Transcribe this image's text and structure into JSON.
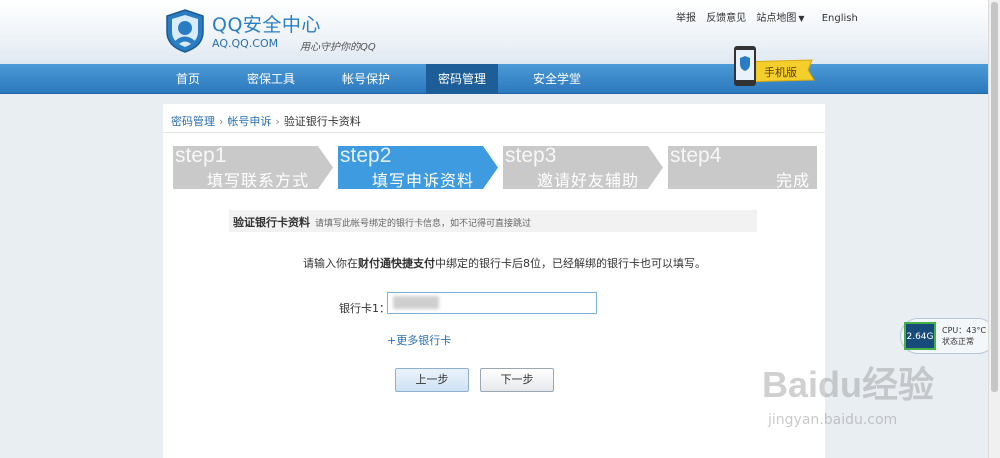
{
  "header": {
    "title": "QQ安全中心",
    "domain": "AQ.QQ.COM",
    "slogan": "用心守护你的QQ",
    "links": [
      "举报",
      "反馈意见",
      "站点地图",
      "English"
    ]
  },
  "nav": {
    "items": [
      "首页",
      "密保工具",
      "帐号保护",
      "密码管理",
      "安全学堂"
    ],
    "active_index": 3,
    "phone_badge": "手机版"
  },
  "breadcrumb": [
    "密码管理",
    "帐号申诉",
    "验证银行卡资料"
  ],
  "steps": [
    {
      "num": "step1",
      "label": "填写联系方式"
    },
    {
      "num": "step2",
      "label": "填写申诉资料"
    },
    {
      "num": "step3",
      "label": "邀请好友辅助"
    },
    {
      "num": "step4",
      "label": "完成"
    }
  ],
  "active_step": 1,
  "section": {
    "title": "验证银行卡资料",
    "hint": "请填写此帐号绑定的银行卡信息，如不记得可直接跳过"
  },
  "instruction": {
    "prefix": "请输入你在",
    "bold": "财付通快捷支付",
    "suffix": "中绑定的银行卡后8位，已经解绑的银行卡也可以填写。"
  },
  "form": {
    "card_label": "银行卡1：",
    "card_value": "",
    "more_cards": "+更多银行卡"
  },
  "buttons": {
    "prev": "上一步",
    "next": "下一步"
  },
  "cpu_widget": {
    "chip": "2.64G",
    "line1": "CPU：43°C",
    "line2": "状态正常"
  },
  "watermark": {
    "text": "Baidu经验",
    "url": "jingyan.baidu.com"
  },
  "colors": {
    "nav": "#2c78bd",
    "step_active": "#3f9be0",
    "step_inactive": "#c9c9c9",
    "link": "#2a6fb0"
  }
}
